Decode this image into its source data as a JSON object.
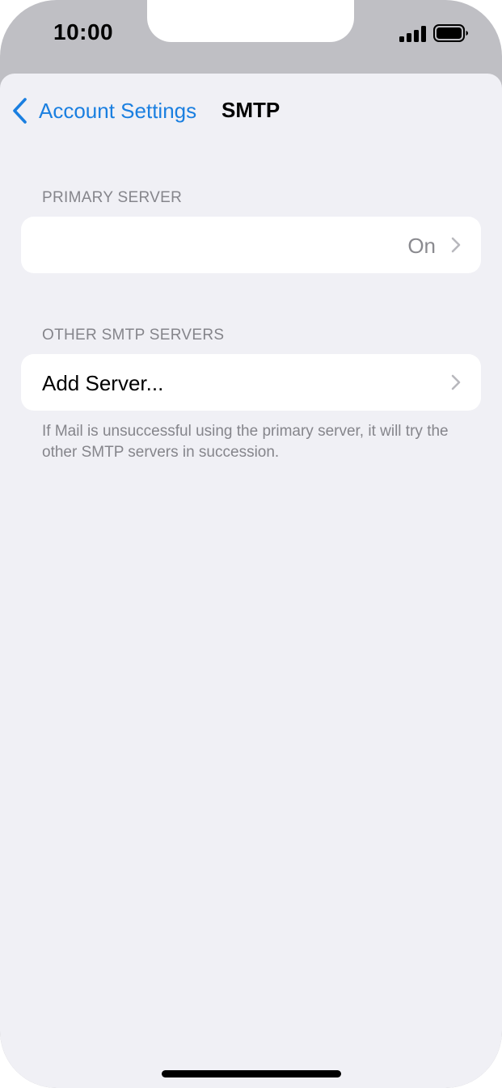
{
  "status_bar": {
    "time": "10:00",
    "icons": [
      "signal-icon",
      "battery-icon"
    ]
  },
  "nav": {
    "back_label": "Account Settings",
    "title": "SMTP"
  },
  "sections": {
    "primary": {
      "header": "PRIMARY SERVER",
      "cell_label": "",
      "cell_value": "On"
    },
    "other": {
      "header": "OTHER SMTP SERVERS",
      "cell_label": "Add Server...",
      "footer": "If Mail is unsuccessful using the primary server, it will try the other SMTP servers in succession."
    }
  },
  "colors": {
    "accent": "#1a7fe0",
    "background": "#f0f0f5",
    "secondary_text": "#85858b"
  }
}
